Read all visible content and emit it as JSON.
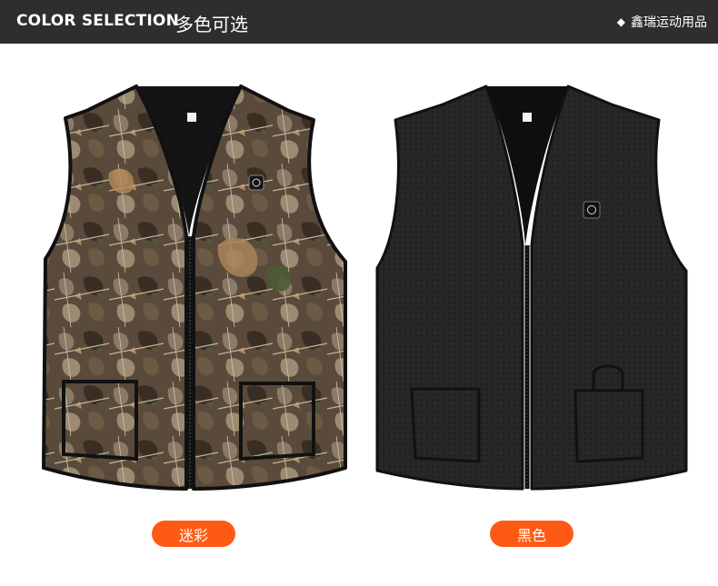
{
  "header": {
    "title_en": "COLOR SELECTION",
    "title_cn": "多色可选",
    "brand_icon": "diamond-icon",
    "brand": "鑫瑞运动用品"
  },
  "products": [
    {
      "label": "迷彩",
      "image": "camouflage-vest"
    },
    {
      "label": "黑色",
      "image": "black-vest"
    }
  ],
  "colors": {
    "header_bg": "#2e2e2e",
    "pill_bg": "#ff5a14",
    "pill_text": "#ffffff"
  }
}
